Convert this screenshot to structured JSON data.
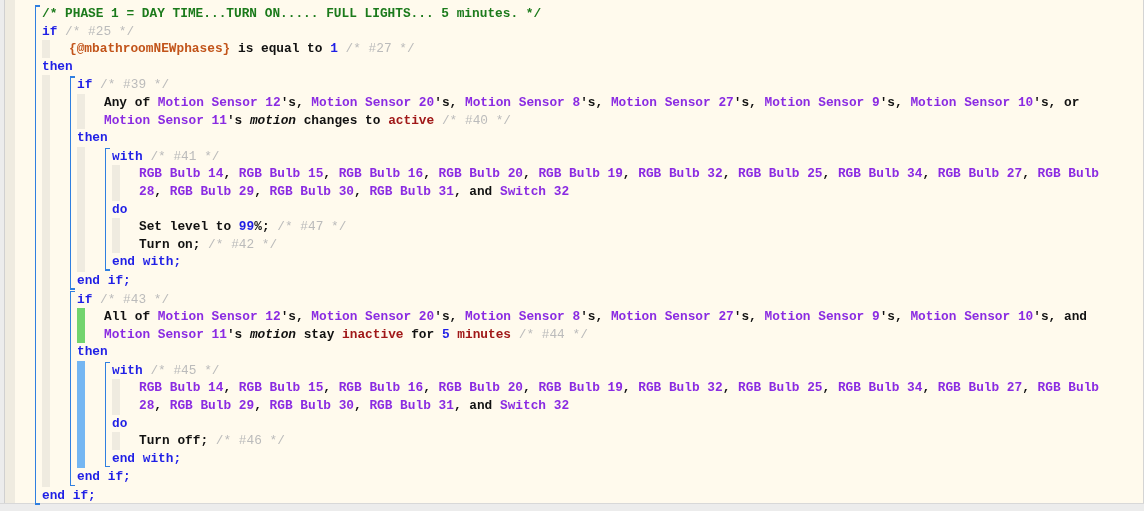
{
  "piston": {
    "kind": "block",
    "children": [
      {
        "kind": "line",
        "tokens": [
          {
            "kind": "note",
            "text": "/* PHASE 1 = DAY TIME...TURN ON..... FULL LIGHTS... 5 minutes. */"
          }
        ]
      },
      {
        "kind": "line",
        "tokens": [
          {
            "kind": "keyword",
            "text": "if"
          },
          {
            "kind": "comment",
            "text": " /* #25 */"
          }
        ]
      },
      {
        "kind": "section",
        "color": "#efebe0",
        "children": [
          {
            "kind": "line",
            "tokens": [
              {
                "kind": "variable",
                "text": "{@mbathroomNEWphases}"
              },
              {
                "kind": "text",
                "text": " is equal to "
              },
              {
                "kind": "number",
                "text": "1"
              },
              {
                "kind": "comment",
                "text": " /* #27 */"
              }
            ]
          }
        ]
      },
      {
        "kind": "line",
        "tokens": [
          {
            "kind": "keyword",
            "text": "then"
          }
        ]
      },
      {
        "kind": "section",
        "color": "#efebe0",
        "children": [
          {
            "kind": "block",
            "children": [
              {
                "kind": "line",
                "tokens": [
                  {
                    "kind": "keyword",
                    "text": "if"
                  },
                  {
                    "kind": "comment",
                    "text": " /* #39 */"
                  }
                ]
              },
              {
                "kind": "section",
                "color": "#efebe0",
                "children": [
                  {
                    "kind": "line",
                    "tokens": [
                      {
                        "kind": "text",
                        "text": "Any of "
                      },
                      {
                        "kind": "device",
                        "text": "Motion Sensor 12"
                      },
                      {
                        "kind": "text",
                        "text": "'s, "
                      },
                      {
                        "kind": "device",
                        "text": "Motion Sensor 20"
                      },
                      {
                        "kind": "text",
                        "text": "'s, "
                      },
                      {
                        "kind": "device",
                        "text": "Motion Sensor 8"
                      },
                      {
                        "kind": "text",
                        "text": "'s, "
                      },
                      {
                        "kind": "device",
                        "text": "Motion Sensor 27"
                      },
                      {
                        "kind": "text",
                        "text": "'s, "
                      },
                      {
                        "kind": "device",
                        "text": "Motion Sensor 9"
                      },
                      {
                        "kind": "text",
                        "text": "'s, "
                      },
                      {
                        "kind": "device",
                        "text": "Motion Sensor 10"
                      },
                      {
                        "kind": "text",
                        "text": "'s, or "
                      },
                      {
                        "kind": "device",
                        "text": "Motion Sensor 11"
                      },
                      {
                        "kind": "text",
                        "text": "'s "
                      },
                      {
                        "kind": "attribute",
                        "text": "motion"
                      },
                      {
                        "kind": "text",
                        "text": " changes to "
                      },
                      {
                        "kind": "value",
                        "text": "active"
                      },
                      {
                        "kind": "comment",
                        "text": " /* #40 */"
                      }
                    ]
                  }
                ]
              },
              {
                "kind": "line",
                "tokens": [
                  {
                    "kind": "keyword",
                    "text": "then"
                  }
                ]
              },
              {
                "kind": "section",
                "color": "#efebe0",
                "children": [
                  {
                    "kind": "block",
                    "children": [
                      {
                        "kind": "line",
                        "tokens": [
                          {
                            "kind": "keyword",
                            "text": "with"
                          },
                          {
                            "kind": "comment",
                            "text": " /* #41 */"
                          }
                        ]
                      },
                      {
                        "kind": "section",
                        "color": "#efebe0",
                        "children": [
                          {
                            "kind": "line",
                            "tokens": [
                              {
                                "kind": "device",
                                "text": "RGB Bulb 14"
                              },
                              {
                                "kind": "text",
                                "text": ", "
                              },
                              {
                                "kind": "device",
                                "text": "RGB Bulb 15"
                              },
                              {
                                "kind": "text",
                                "text": ", "
                              },
                              {
                                "kind": "device",
                                "text": "RGB Bulb 16"
                              },
                              {
                                "kind": "text",
                                "text": ", "
                              },
                              {
                                "kind": "device",
                                "text": "RGB Bulb 20"
                              },
                              {
                                "kind": "text",
                                "text": ", "
                              },
                              {
                                "kind": "device",
                                "text": "RGB Bulb 19"
                              },
                              {
                                "kind": "text",
                                "text": ", "
                              },
                              {
                                "kind": "device",
                                "text": "RGB Bulb 32"
                              },
                              {
                                "kind": "text",
                                "text": ", "
                              },
                              {
                                "kind": "device",
                                "text": "RGB Bulb 25"
                              },
                              {
                                "kind": "text",
                                "text": ", "
                              },
                              {
                                "kind": "device",
                                "text": "RGB Bulb 34"
                              },
                              {
                                "kind": "text",
                                "text": ", "
                              },
                              {
                                "kind": "device",
                                "text": "RGB Bulb 27"
                              },
                              {
                                "kind": "text",
                                "text": ", "
                              },
                              {
                                "kind": "device",
                                "text": "RGB Bulb 28"
                              },
                              {
                                "kind": "text",
                                "text": ", "
                              },
                              {
                                "kind": "device",
                                "text": "RGB Bulb 29"
                              },
                              {
                                "kind": "text",
                                "text": ", "
                              },
                              {
                                "kind": "device",
                                "text": "RGB Bulb 30"
                              },
                              {
                                "kind": "text",
                                "text": ", "
                              },
                              {
                                "kind": "device",
                                "text": "RGB Bulb 31"
                              },
                              {
                                "kind": "text",
                                "text": ", and "
                              },
                              {
                                "kind": "device",
                                "text": "Switch 32"
                              }
                            ]
                          }
                        ]
                      },
                      {
                        "kind": "line",
                        "tokens": [
                          {
                            "kind": "keyword",
                            "text": "do"
                          }
                        ]
                      },
                      {
                        "kind": "section",
                        "color": "#efebe0",
                        "children": [
                          {
                            "kind": "line",
                            "tokens": [
                              {
                                "kind": "text",
                                "text": "Set level to "
                              },
                              {
                                "kind": "number",
                                "text": "99"
                              },
                              {
                                "kind": "text",
                                "text": "%;"
                              },
                              {
                                "kind": "comment",
                                "text": " /* #47 */"
                              }
                            ]
                          },
                          {
                            "kind": "line",
                            "tokens": [
                              {
                                "kind": "text",
                                "text": "Turn on;"
                              },
                              {
                                "kind": "comment",
                                "text": " /* #42 */"
                              }
                            ]
                          }
                        ]
                      },
                      {
                        "kind": "line",
                        "tokens": [
                          {
                            "kind": "keyword",
                            "text": "end with;"
                          }
                        ]
                      }
                    ]
                  }
                ]
              },
              {
                "kind": "line",
                "tokens": [
                  {
                    "kind": "keyword",
                    "text": "end if;"
                  }
                ]
              }
            ]
          },
          {
            "kind": "block",
            "children": [
              {
                "kind": "line",
                "tokens": [
                  {
                    "kind": "keyword",
                    "text": "if"
                  },
                  {
                    "kind": "comment",
                    "text": " /* #43 */"
                  }
                ]
              },
              {
                "kind": "section",
                "color": "#72d46e",
                "children": [
                  {
                    "kind": "line",
                    "tokens": [
                      {
                        "kind": "text",
                        "text": "All of "
                      },
                      {
                        "kind": "device",
                        "text": "Motion Sensor 12"
                      },
                      {
                        "kind": "text",
                        "text": "'s, "
                      },
                      {
                        "kind": "device",
                        "text": "Motion Sensor 20"
                      },
                      {
                        "kind": "text",
                        "text": "'s, "
                      },
                      {
                        "kind": "device",
                        "text": "Motion Sensor 8"
                      },
                      {
                        "kind": "text",
                        "text": "'s, "
                      },
                      {
                        "kind": "device",
                        "text": "Motion Sensor 27"
                      },
                      {
                        "kind": "text",
                        "text": "'s, "
                      },
                      {
                        "kind": "device",
                        "text": "Motion Sensor 9"
                      },
                      {
                        "kind": "text",
                        "text": "'s, "
                      },
                      {
                        "kind": "device",
                        "text": "Motion Sensor 10"
                      },
                      {
                        "kind": "text",
                        "text": "'s, and "
                      },
                      {
                        "kind": "device",
                        "text": "Motion Sensor 11"
                      },
                      {
                        "kind": "text",
                        "text": "'s "
                      },
                      {
                        "kind": "attribute",
                        "text": "motion"
                      },
                      {
                        "kind": "text",
                        "text": " stay "
                      },
                      {
                        "kind": "value",
                        "text": "inactive"
                      },
                      {
                        "kind": "text",
                        "text": " for "
                      },
                      {
                        "kind": "number",
                        "text": "5"
                      },
                      {
                        "kind": "value",
                        "text": " minutes"
                      },
                      {
                        "kind": "comment",
                        "text": " /* #44 */"
                      }
                    ]
                  }
                ]
              },
              {
                "kind": "line",
                "tokens": [
                  {
                    "kind": "keyword",
                    "text": "then"
                  }
                ]
              },
              {
                "kind": "section",
                "color": "#74b6f2",
                "children": [
                  {
                    "kind": "block",
                    "children": [
                      {
                        "kind": "line",
                        "tokens": [
                          {
                            "kind": "keyword",
                            "text": "with"
                          },
                          {
                            "kind": "comment",
                            "text": " /* #45 */"
                          }
                        ]
                      },
                      {
                        "kind": "section",
                        "color": "#efebe0",
                        "children": [
                          {
                            "kind": "line",
                            "tokens": [
                              {
                                "kind": "device",
                                "text": "RGB Bulb 14"
                              },
                              {
                                "kind": "text",
                                "text": ", "
                              },
                              {
                                "kind": "device",
                                "text": "RGB Bulb 15"
                              },
                              {
                                "kind": "text",
                                "text": ", "
                              },
                              {
                                "kind": "device",
                                "text": "RGB Bulb 16"
                              },
                              {
                                "kind": "text",
                                "text": ", "
                              },
                              {
                                "kind": "device",
                                "text": "RGB Bulb 20"
                              },
                              {
                                "kind": "text",
                                "text": ", "
                              },
                              {
                                "kind": "device",
                                "text": "RGB Bulb 19"
                              },
                              {
                                "kind": "text",
                                "text": ", "
                              },
                              {
                                "kind": "device",
                                "text": "RGB Bulb 32"
                              },
                              {
                                "kind": "text",
                                "text": ", "
                              },
                              {
                                "kind": "device",
                                "text": "RGB Bulb 25"
                              },
                              {
                                "kind": "text",
                                "text": ", "
                              },
                              {
                                "kind": "device",
                                "text": "RGB Bulb 34"
                              },
                              {
                                "kind": "text",
                                "text": ", "
                              },
                              {
                                "kind": "device",
                                "text": "RGB Bulb 27"
                              },
                              {
                                "kind": "text",
                                "text": ", "
                              },
                              {
                                "kind": "device",
                                "text": "RGB Bulb 28"
                              },
                              {
                                "kind": "text",
                                "text": ", "
                              },
                              {
                                "kind": "device",
                                "text": "RGB Bulb 29"
                              },
                              {
                                "kind": "text",
                                "text": ", "
                              },
                              {
                                "kind": "device",
                                "text": "RGB Bulb 30"
                              },
                              {
                                "kind": "text",
                                "text": ", "
                              },
                              {
                                "kind": "device",
                                "text": "RGB Bulb 31"
                              },
                              {
                                "kind": "text",
                                "text": ", and "
                              },
                              {
                                "kind": "device",
                                "text": "Switch 32"
                              }
                            ]
                          }
                        ]
                      },
                      {
                        "kind": "line",
                        "tokens": [
                          {
                            "kind": "keyword",
                            "text": "do"
                          }
                        ]
                      },
                      {
                        "kind": "section",
                        "color": "#efebe0",
                        "children": [
                          {
                            "kind": "line",
                            "tokens": [
                              {
                                "kind": "text",
                                "text": "Turn off;"
                              },
                              {
                                "kind": "comment",
                                "text": " /* #46 */"
                              }
                            ]
                          }
                        ]
                      },
                      {
                        "kind": "line",
                        "tokens": [
                          {
                            "kind": "keyword",
                            "text": "end with;"
                          }
                        ]
                      }
                    ]
                  }
                ]
              },
              {
                "kind": "line",
                "tokens": [
                  {
                    "kind": "keyword",
                    "text": "end if;"
                  }
                ]
              }
            ]
          }
        ]
      },
      {
        "kind": "line",
        "tokens": [
          {
            "kind": "keyword",
            "text": "end if;"
          }
        ]
      }
    ]
  }
}
